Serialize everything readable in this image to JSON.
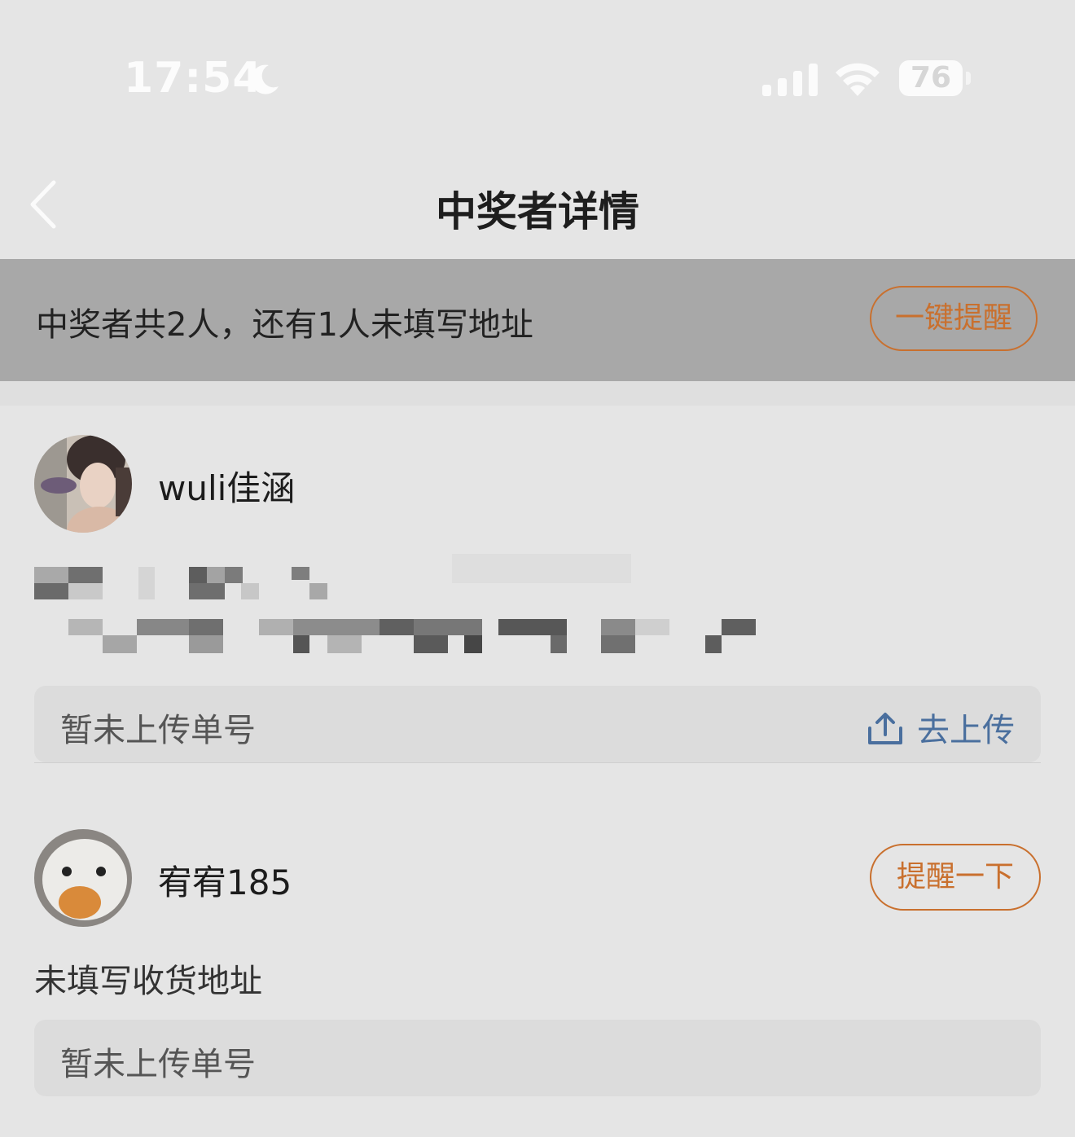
{
  "status_bar": {
    "time": "17:54",
    "battery": "76",
    "icons": [
      "moon-icon",
      "cellular-signal-icon",
      "wifi-icon",
      "battery-icon"
    ]
  },
  "nav": {
    "title": "中奖者详情",
    "back_icon": "chevron-left-icon"
  },
  "banner": {
    "summary": "中奖者共2人，还有1人未填写地址",
    "remind_all_label": "一键提醒"
  },
  "winners": [
    {
      "name": "wuli佳涵",
      "tracking_status": "暂未上传单号",
      "upload_label": "去上传",
      "upload_icon": "upload-icon"
    },
    {
      "name": "宥宥185",
      "remind_label": "提醒一下",
      "address_status": "未填写收货地址",
      "tracking_status": "暂未上传单号"
    }
  ],
  "colors": {
    "accent_orange": "#c9702e",
    "link_blue": "#4a6f9e",
    "banner_gray": "#a8a8a8"
  }
}
